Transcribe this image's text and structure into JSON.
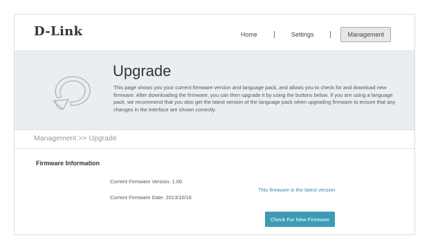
{
  "brand": {
    "logo": "D-Link"
  },
  "nav": {
    "items": [
      {
        "label": "Home"
      },
      {
        "label": "Settings"
      },
      {
        "label": "Management"
      }
    ],
    "active": "Management"
  },
  "banner": {
    "icon": "upgrade-icon",
    "title": "Upgrade",
    "description": "This page shows you your current firmware version and language pack, and allows you to check for and download new firmware. After downloading the firmware, you can then upgrade it by using the buttons below. If you are using a language pack, we recommend that you also get the latest version of the language pack when upgrading firmware to ensure that any changes in the interface are shown correctly."
  },
  "breadcrumb": "Management >> Upgrade",
  "firmware": {
    "section_title": "Firmware Information",
    "version_text": "Current Firmware Version: 1.00",
    "date_text": "Current Firmware Date: 2013/10/16",
    "status_text": "This firmware is the latest version",
    "check_button_label": "Check For New Firmware"
  },
  "colors": {
    "accent": "#3d9bb4",
    "status_text": "#3a8ca8",
    "banner_bg": "#eaeef0"
  }
}
